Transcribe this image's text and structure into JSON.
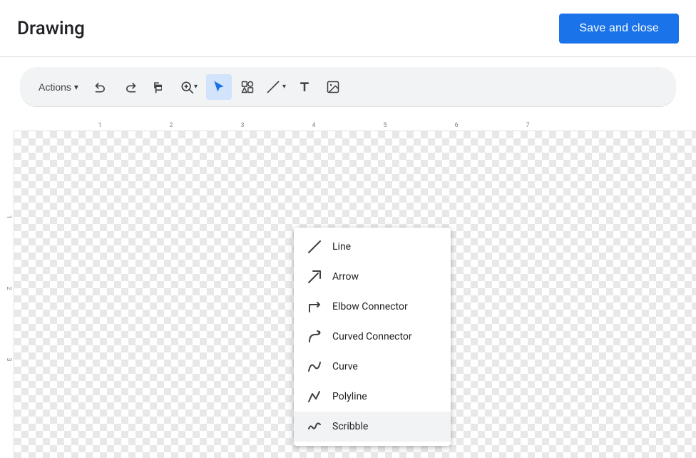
{
  "header": {
    "title": "Drawing",
    "save_close_label": "Save and close"
  },
  "toolbar": {
    "actions_label": "Actions",
    "tools": [
      {
        "name": "undo",
        "icon": "undo",
        "label": "Undo"
      },
      {
        "name": "redo",
        "icon": "redo",
        "label": "Redo"
      },
      {
        "name": "paint-format",
        "icon": "paint",
        "label": "Paint format"
      },
      {
        "name": "zoom",
        "icon": "zoom",
        "label": "Zoom"
      },
      {
        "name": "select",
        "icon": "cursor",
        "label": "Select",
        "active": true
      },
      {
        "name": "shapes",
        "icon": "shapes",
        "label": "Shapes"
      },
      {
        "name": "line",
        "icon": "line",
        "label": "Line/Arrow",
        "has_dropdown": true
      },
      {
        "name": "text",
        "icon": "text",
        "label": "Text box"
      },
      {
        "name": "image",
        "icon": "image",
        "label": "Image"
      }
    ]
  },
  "line_menu": {
    "items": [
      {
        "id": "line",
        "label": "Line"
      },
      {
        "id": "arrow",
        "label": "Arrow"
      },
      {
        "id": "elbow-connector",
        "label": "Elbow Connector"
      },
      {
        "id": "curved-connector",
        "label": "Curved Connector"
      },
      {
        "id": "curve",
        "label": "Curve"
      },
      {
        "id": "polyline",
        "label": "Polyline"
      },
      {
        "id": "scribble",
        "label": "Scribble"
      }
    ]
  },
  "ruler": {
    "h_ticks": [
      "1",
      "2",
      "3",
      "4",
      "5",
      "6",
      "7"
    ],
    "v_ticks": [
      "1",
      "2",
      "3"
    ]
  }
}
